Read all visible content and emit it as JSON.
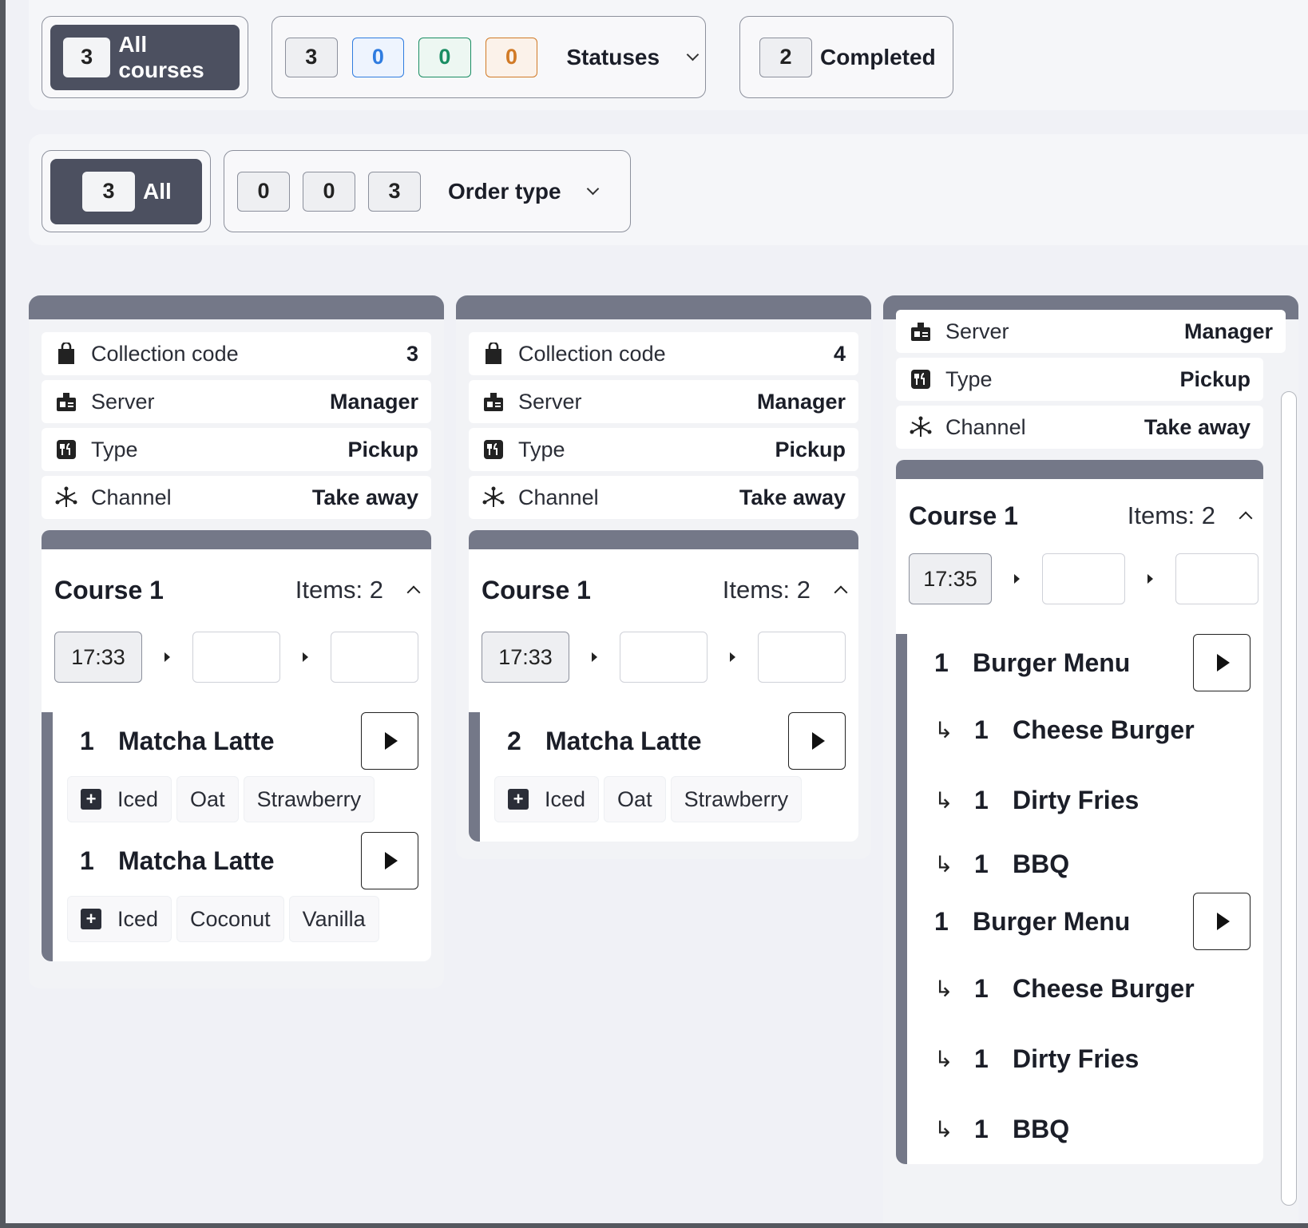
{
  "filters": {
    "courses": {
      "all": {
        "count": "3",
        "label": "All courses"
      },
      "statuses": {
        "counts": [
          "3",
          "0",
          "0",
          "0"
        ],
        "label": "Statuses"
      },
      "completed": {
        "count": "2",
        "label": "Completed"
      }
    },
    "orders": {
      "all": {
        "count": "3",
        "label": "All"
      },
      "order_type": {
        "counts": [
          "0",
          "0",
          "3"
        ],
        "label": "Order type"
      }
    }
  },
  "orders": [
    {
      "info": [
        {
          "label": "Collection code",
          "value": "3"
        },
        {
          "label": "Server",
          "value": "Manager"
        },
        {
          "label": "Type",
          "value": "Pickup"
        },
        {
          "label": "Channel",
          "value": "Take away"
        }
      ],
      "course": {
        "name": "Course 1",
        "items_label": "Items: 2",
        "times": [
          "17:33",
          "",
          ""
        ],
        "items": [
          {
            "qty": "1",
            "name": "Matcha Latte",
            "mods": [
              "Iced",
              "Oat",
              "Strawberry"
            ]
          },
          {
            "qty": "1",
            "name": "Matcha Latte",
            "mods": [
              "Iced",
              "Coconut",
              "Vanilla"
            ]
          }
        ]
      }
    },
    {
      "info": [
        {
          "label": "Collection code",
          "value": "4"
        },
        {
          "label": "Server",
          "value": "Manager"
        },
        {
          "label": "Type",
          "value": "Pickup"
        },
        {
          "label": "Channel",
          "value": "Take away"
        }
      ],
      "course": {
        "name": "Course 1",
        "items_label": "Items: 2",
        "times": [
          "17:33",
          "",
          ""
        ],
        "items": [
          {
            "qty": "2",
            "name": "Matcha Latte",
            "mods": [
              "Iced",
              "Oat",
              "Strawberry"
            ]
          }
        ]
      }
    },
    {
      "info": [
        {
          "label": "Server",
          "value": "Manager"
        },
        {
          "label": "Type",
          "value": "Pickup"
        },
        {
          "label": "Channel",
          "value": "Take away"
        }
      ],
      "course": {
        "name": "Course 1",
        "items_label": "Items: 2",
        "times": [
          "17:35",
          "",
          ""
        ],
        "items": [
          {
            "qty": "1",
            "name": "Burger Menu",
            "subs": [
              {
                "arrow": "↳",
                "qty": "1",
                "name": "Cheese Burger"
              },
              {
                "arrow": "↳",
                "qty": "1",
                "name": "Dirty Fries"
              },
              {
                "arrow": "↳",
                "qty": "1",
                "name": "BBQ"
              }
            ]
          },
          {
            "qty": "1",
            "name": "Burger Menu",
            "subs": [
              {
                "arrow": "↳",
                "qty": "1",
                "name": "Cheese Burger"
              },
              {
                "arrow": "↳",
                "qty": "1",
                "name": "Dirty Fries"
              },
              {
                "arrow": "↳",
                "qty": "1",
                "name": "BBQ"
              }
            ]
          }
        ]
      }
    }
  ]
}
